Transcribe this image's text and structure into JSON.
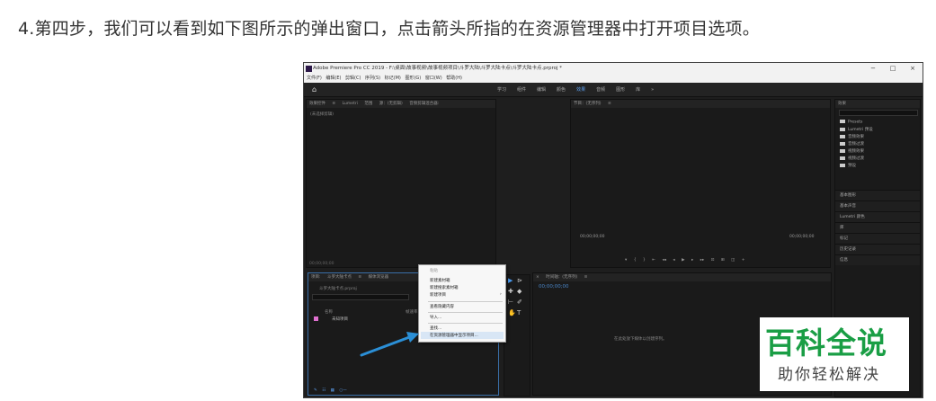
{
  "article": {
    "step_text": "4.第四步，我们可以看到如下图所示的弹出窗口，点击箭头所指的在资源管理器中打开项目选项。"
  },
  "screenshot": {
    "window_title": "Adobe Premiere Pro CC 2019 - F:\\桌面\\故事视频\\故事视频项目\\斗罗大陆\\斗罗大陆卡点\\斗罗大陆卡点.prproj *",
    "window_controls": [
      "−",
      "□",
      "×"
    ],
    "menu": "文件(F) 编辑(E) 剪辑(C) 序列(S) 标记(M) 图形(G) 窗口(W) 帮助(H)",
    "workspaces": [
      "学习",
      "组件",
      "编辑",
      "颜色",
      "效果",
      "音频",
      "图形",
      "库",
      "»"
    ],
    "active_workspace": "效果",
    "source_tabs": "效果控件 ≡   Lumetri 范围   源：(无剪辑)   音频剪辑混合器:",
    "source_empty": "(未选择剪辑)",
    "source_tc": "00;00;00;00",
    "program_tab": "节目：(无序列) ≡",
    "program_tc_left": "00;00;00;00",
    "program_tc_right": "00;00;00;00",
    "project_tabs": "项目: 斗罗大陆卡点 ≡   媒体浏览器",
    "project_file": "斗罗大陆卡点.prproj",
    "project_col_name": "名称",
    "project_col_rate": "帧速率",
    "project_item": "未知项目",
    "timeline_tab": "× 时间轴：(无序列) ≡",
    "timeline_tc": "00;00;00;00",
    "timeline_empty": "在此处放下媒体以创建序列。",
    "effects_title": "效果",
    "effects_items": [
      "Presets",
      "Lumetri 预设",
      "音频效果",
      "音频过渡",
      "视频效果",
      "视频过渡",
      "预设"
    ],
    "right_buttons": [
      "基本图形",
      "基本声音",
      "Lumetri 颜色",
      "库",
      "标记",
      "历史记录",
      "信息"
    ],
    "context_menu": {
      "items": [
        "粘贴",
        "新建素材箱",
        "新建搜索素材箱",
        "新建项目",
        "查看隐藏内容",
        "导入...",
        "查找...",
        "在资源管理器中显示项目..."
      ]
    }
  },
  "watermark": {
    "title": "百科全说",
    "subtitle": "助你轻松解决"
  },
  "colors": {
    "highlight_arrow": "#2b8fd6",
    "watermark_green": "#1a9e45"
  }
}
